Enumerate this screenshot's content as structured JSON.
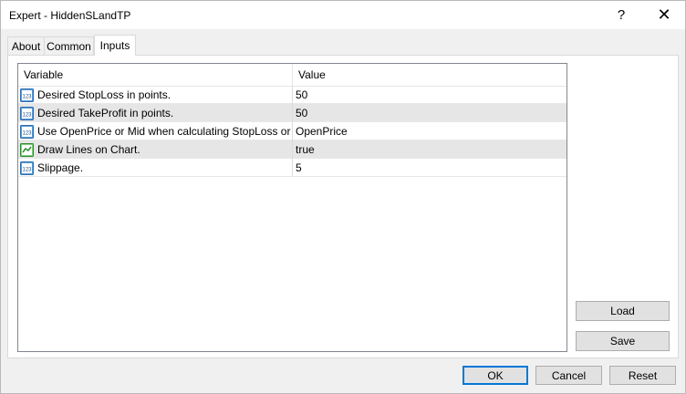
{
  "window": {
    "title": "Expert - HiddenSLandTP",
    "help_glyph": "?",
    "close_glyph": "✕"
  },
  "tabs": [
    {
      "label": "About"
    },
    {
      "label": "Common"
    },
    {
      "label": "Inputs"
    }
  ],
  "grid": {
    "headers": {
      "variable": "Variable",
      "value": "Value"
    },
    "rows": [
      {
        "icon": "integer-param-icon",
        "variable": "Desired StopLoss in points.",
        "value": "50"
      },
      {
        "icon": "integer-param-icon",
        "variable": "Desired TakeProfit in points.",
        "value": "50"
      },
      {
        "icon": "integer-param-icon",
        "variable": "Use OpenPrice or Mid when calculating StopLoss or Ta...",
        "value": "OpenPrice"
      },
      {
        "icon": "boolean-param-icon",
        "variable": "Draw Lines on Chart.",
        "value": "true"
      },
      {
        "icon": "integer-param-icon",
        "variable": "Slippage.",
        "value": "5"
      }
    ]
  },
  "side_buttons": {
    "load": "Load",
    "save": "Save"
  },
  "footer_buttons": {
    "ok": "OK",
    "cancel": "Cancel",
    "reset": "Reset"
  },
  "icon_glyph": "123",
  "colors": {
    "accent": "#0078d7",
    "alt_row": "#e6e6e6"
  }
}
